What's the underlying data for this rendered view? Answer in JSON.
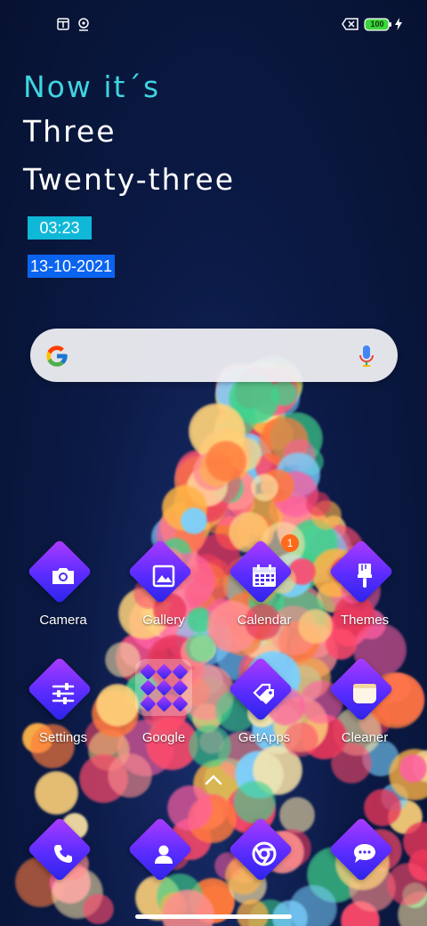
{
  "status_bar": {
    "left_icons": [
      "screen-icon",
      "location-pin-icon"
    ],
    "right_icons": [
      "battery-saver-icon",
      "battery-icon",
      "charging-icon"
    ],
    "battery_level": "100"
  },
  "clock_widget": {
    "line1": "Now it´s",
    "line2": "Three",
    "line3": "Twenty-three",
    "time": "03:23",
    "date": "13-10-2021"
  },
  "search_bar": {
    "logo": "google-g-icon",
    "mic_icon": "microphone-icon"
  },
  "apps_row1": [
    {
      "label": "Camera",
      "icon": "camera-icon"
    },
    {
      "label": "Gallery",
      "icon": "gallery-icon"
    },
    {
      "label": "Calendar",
      "icon": "calendar-icon",
      "badge": "1"
    },
    {
      "label": "Themes",
      "icon": "paintbrush-icon"
    }
  ],
  "apps_row2": [
    {
      "label": "Settings",
      "icon": "sliders-icon"
    },
    {
      "label": "Google",
      "icon": "folder-icon"
    },
    {
      "label": "GetApps",
      "icon": "tags-icon"
    },
    {
      "label": "Cleaner",
      "icon": "cleaner-icon"
    }
  ],
  "dock": [
    {
      "icon": "phone-icon"
    },
    {
      "icon": "contacts-icon"
    },
    {
      "icon": "chrome-icon"
    },
    {
      "icon": "messages-icon"
    }
  ],
  "colors": {
    "accent_cyan": "#3fd4e0",
    "time_badge": "#10b8d8",
    "date_badge": "#0b64f0",
    "icon_gradient_start": "#b03cff",
    "icon_gradient_end": "#2a24e8",
    "notification": "#ff6a1a"
  }
}
